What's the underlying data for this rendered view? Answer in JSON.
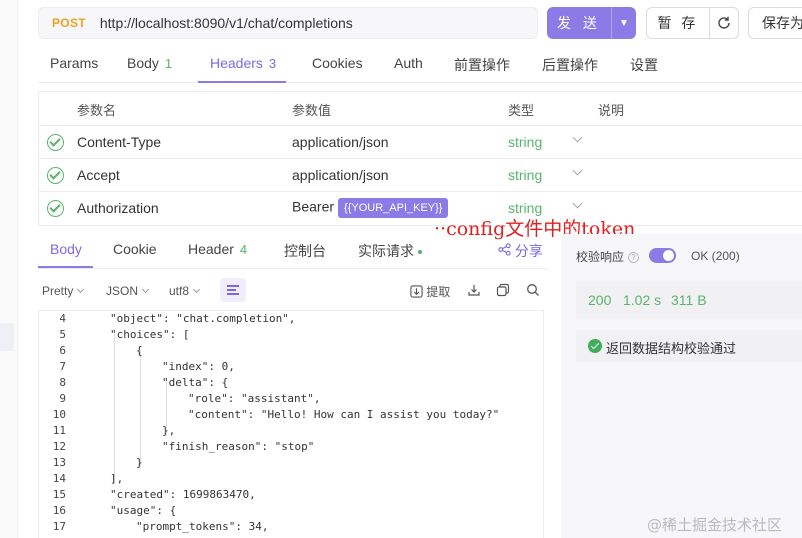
{
  "request": {
    "method": "POST",
    "url": "http://localhost:8090/v1/chat/completions",
    "send_label": "发 送",
    "save_label": "暂 存",
    "save_as_label": "保存为"
  },
  "request_tabs": [
    {
      "label": "Params",
      "count": ""
    },
    {
      "label": "Body",
      "count": "1"
    },
    {
      "label": "Headers",
      "count": "3"
    },
    {
      "label": "Cookies",
      "count": ""
    },
    {
      "label": "Auth",
      "count": ""
    },
    {
      "label": "前置操作",
      "count": ""
    },
    {
      "label": "后置操作",
      "count": ""
    },
    {
      "label": "设置",
      "count": ""
    }
  ],
  "headers_table": {
    "columns": [
      "参数名",
      "参数值",
      "类型",
      "说明"
    ],
    "rows": [
      {
        "name": "Content-Type",
        "value": "application/json",
        "type": "string"
      },
      {
        "name": "Accept",
        "value": "application/json",
        "type": "string"
      },
      {
        "name": "Authorization",
        "value": "Bearer",
        "variable": "{{YOUR_API_KEY}}",
        "type": "string"
      }
    ]
  },
  "annotation": "config文件中的token",
  "response_tabs": [
    {
      "label": "Body",
      "count": ""
    },
    {
      "label": "Cookie",
      "count": ""
    },
    {
      "label": "Header",
      "count": "4"
    },
    {
      "label": "控制台",
      "count": ""
    },
    {
      "label": "实际请求",
      "count": ""
    }
  ],
  "share_label": "分享",
  "toolbar": {
    "view": "Pretty",
    "format": "JSON",
    "encoding": "utf8",
    "extract_label": "提取"
  },
  "code_lines": [
    {
      "n": "4",
      "indent": 1,
      "text": "\"object\": \"chat.completion\","
    },
    {
      "n": "5",
      "indent": 1,
      "text": "\"choices\": ["
    },
    {
      "n": "6",
      "indent": 2,
      "text": "{"
    },
    {
      "n": "7",
      "indent": 3,
      "text": "\"index\": 0,"
    },
    {
      "n": "8",
      "indent": 3,
      "text": "\"delta\": {"
    },
    {
      "n": "9",
      "indent": 4,
      "text": "\"role\": \"assistant\","
    },
    {
      "n": "10",
      "indent": 4,
      "text": "\"content\": \"Hello! How can I assist you today?\""
    },
    {
      "n": "11",
      "indent": 3,
      "text": "},"
    },
    {
      "n": "12",
      "indent": 3,
      "text": "\"finish_reason\": \"stop\""
    },
    {
      "n": "13",
      "indent": 2,
      "text": "}"
    },
    {
      "n": "14",
      "indent": 1,
      "text": "],"
    },
    {
      "n": "15",
      "indent": 1,
      "text": "\"created\": 1699863470,"
    },
    {
      "n": "16",
      "indent": 1,
      "text": "\"usage\": {"
    },
    {
      "n": "17",
      "indent": 2,
      "text": "\"prompt_tokens\": 34,"
    }
  ],
  "validation": {
    "label": "校验响应",
    "help": "?",
    "status": "OK (200)",
    "code": "200",
    "time": "1.02 s",
    "size": "311 B",
    "result": "返回数据结构校验通过"
  },
  "watermark": "@稀土掘金技术社区",
  "colors": {
    "accent": "#8c7ae6",
    "method": "#f0a020",
    "success": "#59b36c",
    "annotation": "#e02020"
  }
}
